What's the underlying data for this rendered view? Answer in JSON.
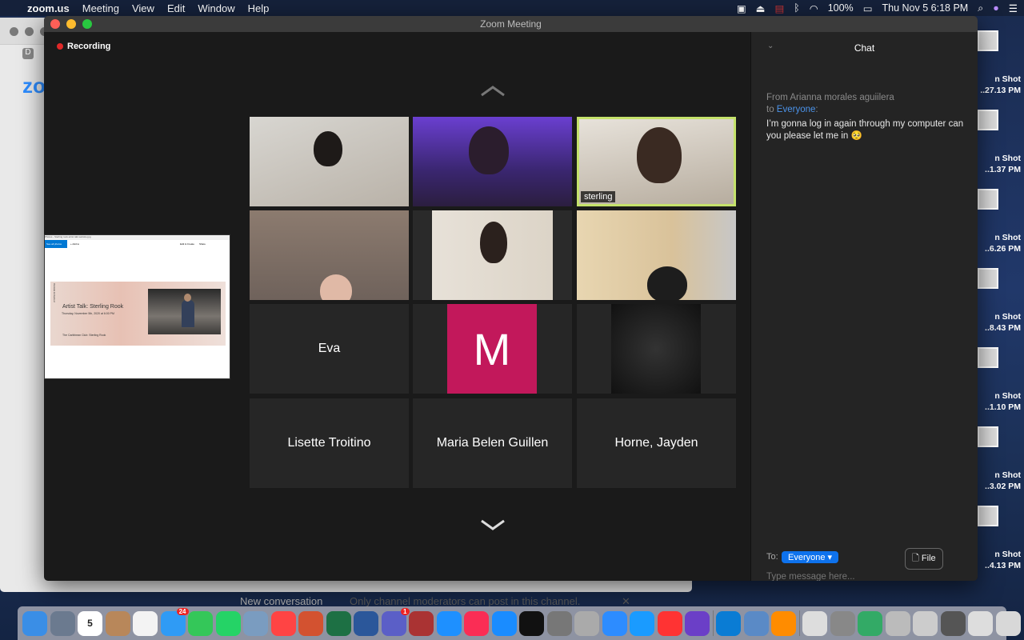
{
  "menubar": {
    "app": "zoom.us",
    "items": [
      "Meeting",
      "View",
      "Edit",
      "Window",
      "Help"
    ],
    "battery": "100%",
    "datetime": "Thu Nov 5  6:18 PM"
  },
  "background_window": {
    "tab_letter": "D",
    "logo": "zoom",
    "new_conversation": "New conversation",
    "notice": "Only channel moderators can post in this channel.",
    "close": "✕"
  },
  "window": {
    "title": "Zoom Meeting",
    "recording": "Recording"
  },
  "share": {
    "app_title": "Photos - Sterling rook artist talk website.jpg",
    "see_all": "See all photos",
    "add_to": "+ Add to",
    "edit_create": "Edit & Create",
    "share": "Share",
    "banner_title": "Artist Talk: Sterling Rook",
    "banner_date": "Thursday, November 5th, 2020 at 6:00 PM",
    "banner_show": "The Caribbean Club: Sterling Rook",
    "banner_vertical": "Outside Entwined"
  },
  "participants": [
    {
      "label": ""
    },
    {
      "label": ""
    },
    {
      "label": "sterling",
      "active": true
    },
    {
      "label": ""
    },
    {
      "label": ""
    },
    {
      "label": ""
    },
    {
      "name": "Eva"
    },
    {
      "avatar": "M",
      "avatar_color": "#c2185b"
    },
    {
      "label": ""
    },
    {
      "name": "Lisette Troitino"
    },
    {
      "name": "Maria Belen Guillen"
    },
    {
      "name": "Horne, Jayden"
    }
  ],
  "chat": {
    "title": "Chat",
    "from": "From Arianna morales aguiilera",
    "to_prefix": "to ",
    "to_target": "Everyone",
    "to_suffix": ":",
    "message": "I’m gonna log in again through my computer can you please let me in 🥺",
    "to_label": "To:",
    "recipient": "Everyone ▾",
    "file": "File",
    "placeholder": "Type message here..."
  },
  "desktop": [
    {
      "l1": "n Shot",
      "l2": "..27.13 PM"
    },
    {
      "l1": "n Shot",
      "l2": "..1.37 PM"
    },
    {
      "l1": "n Shot",
      "l2": "..6.26 PM"
    },
    {
      "l1": "n Shot",
      "l2": "..8.43 PM"
    },
    {
      "l1": "n Shot",
      "l2": "..1.10 PM"
    },
    {
      "l1": "n Shot",
      "l2": "..3.02 PM"
    },
    {
      "l1": "n Shot",
      "l2": "..4.13 PM"
    }
  ],
  "dock": {
    "calendar_day": "5",
    "messages_badge": "24",
    "teams_badge": "1"
  }
}
